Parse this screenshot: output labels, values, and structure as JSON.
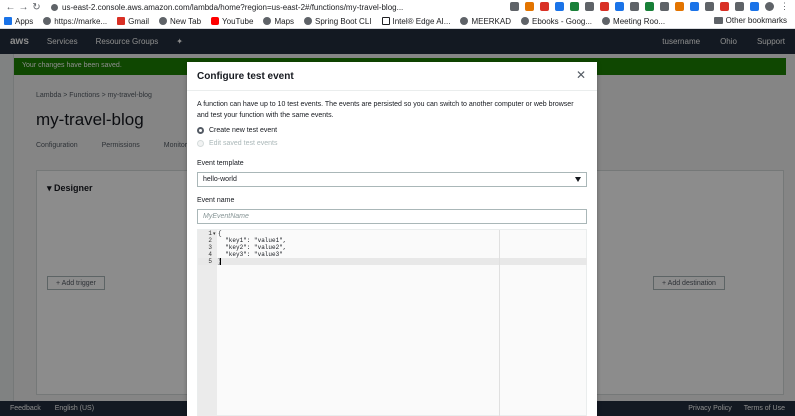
{
  "browser": {
    "url": "us-east-2.console.aws.amazon.com/lambda/home?region=us-east-2#/functions/my-travel-blog...",
    "bookmarks": [
      {
        "label": "Apps"
      },
      {
        "label": "https://marke..."
      },
      {
        "label": "Gmail"
      },
      {
        "label": "New Tab"
      },
      {
        "label": "YouTube"
      },
      {
        "label": "Maps"
      },
      {
        "label": "Spring Boot CLI"
      },
      {
        "label": "Intel® Edge AI..."
      },
      {
        "label": "MEERKAD"
      },
      {
        "label": "Ebooks - Goog..."
      },
      {
        "label": "Meeting Roo..."
      }
    ],
    "other_bookmarks": "Other bookmarks",
    "colors": {
      "ext1": "#5f6368",
      "ext2": "#e37400",
      "ext3": "#d93025",
      "ext4": "#1a73e8",
      "ext5": "#188038"
    }
  },
  "background": {
    "aws_logo": "aws",
    "nav": [
      "Services",
      "Resource Groups"
    ],
    "top_right": [
      "tusername",
      "Ohio",
      "Support"
    ],
    "flash": "Your changes have been saved.",
    "breadcrumb": "Lambda > Functions > my-travel-blog",
    "page_title": "my-travel-blog",
    "tabs": [
      "Configuration",
      "Permissions",
      "Monitoring"
    ],
    "designer_title": "Designer",
    "add_trigger": "+ Add trigger",
    "add_destination": "+ Add destination",
    "footer_left": [
      "Feedback",
      "English (US)"
    ],
    "footer_right": [
      "Privacy Policy",
      "Terms of Use"
    ]
  },
  "modal": {
    "title": "Configure test event",
    "description": "A function can have up to 10 test events. The events are persisted so you can switch to another computer or web browser and test your function with the same events.",
    "radio_create": "Create new test event",
    "radio_edit": "Edit saved test events",
    "template_label": "Event template",
    "template_value": "hello-world",
    "name_label": "Event name",
    "name_placeholder": "MyEventName",
    "editor_lines": [
      {
        "n": "1",
        "text": "{"
      },
      {
        "n": "2",
        "text": "  \"key1\": \"value1\","
      },
      {
        "n": "3",
        "text": "  \"key2\": \"value2\","
      },
      {
        "n": "4",
        "text": "  \"key3\": \"value3\""
      },
      {
        "n": "5",
        "text": "}"
      }
    ],
    "close_icon": "close-icon"
  }
}
